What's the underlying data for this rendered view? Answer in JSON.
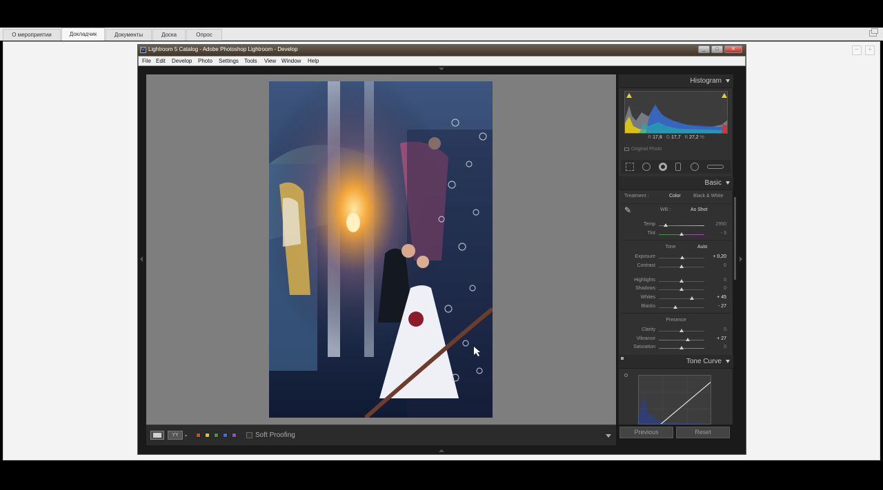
{
  "browser": {
    "tabs": [
      {
        "label": "О мероприятии"
      },
      {
        "label": "Докладчик"
      },
      {
        "label": "Документы"
      },
      {
        "label": "Доска"
      },
      {
        "label": "Опрос"
      }
    ],
    "active_tab": "Докладчик",
    "zoom_out": "−",
    "zoom_in": "+"
  },
  "lightroom": {
    "window_title": "Lightroom 5 Catalog - Adobe Photoshop Lightroom - Develop",
    "app_icon_text": "Lr",
    "menu": [
      "File",
      "Edit",
      "Develop",
      "Photo",
      "Settings",
      "Tools",
      "View",
      "Window",
      "Help"
    ],
    "toolbar": {
      "before_after_label": "YY",
      "soft_proofing_label": "Soft Proofing",
      "color_flags": [
        "#d9452c",
        "#d8c52a",
        "#3e9a3b",
        "#3a6fd0",
        "#8a52c9"
      ]
    },
    "panel": {
      "histogram_title": "Histogram",
      "rgb": {
        "r_label": "R",
        "r": "17,8",
        "g_label": "G",
        "g": "17,7",
        "b_label": "B",
        "b": "27,2",
        "unit": "%"
      },
      "original_photo_label": "Original Photo",
      "basic_title": "Basic",
      "treatment_label": "Treatment :",
      "treatment_color": "Color",
      "treatment_bw": "Black & White",
      "wb_label": "WB :",
      "wb_value": "As Shot",
      "temp": {
        "label": "Temp",
        "value": "2950",
        "pos": 0.15
      },
      "tint": {
        "label": "Tint",
        "value": "- 3",
        "pos": 0.5
      },
      "tone_label": "Tone",
      "auto_label": "Auto",
      "exposure": {
        "label": "Exposure",
        "value": "+ 0,20",
        "pos": 0.52
      },
      "contrast": {
        "label": "Contrast",
        "value": "0",
        "pos": 0.5
      },
      "highlights": {
        "label": "Highlights",
        "value": "0",
        "pos": 0.5
      },
      "shadows": {
        "label": "Shadows",
        "value": "0",
        "pos": 0.5
      },
      "whites": {
        "label": "Whites",
        "value": "+ 45",
        "pos": 0.72
      },
      "blacks": {
        "label": "Blacks",
        "value": "- 27",
        "pos": 0.37
      },
      "presence_label": "Presence",
      "clarity": {
        "label": "Clarity",
        "value": "0",
        "pos": 0.5
      },
      "vibrance": {
        "label": "Vibrance",
        "value": "+ 27",
        "pos": 0.63
      },
      "saturation": {
        "label": "Saturation",
        "value": "0",
        "pos": 0.5
      },
      "tone_curve_title": "Tone Curve",
      "previous_label": "Previous",
      "reset_label": "Reset"
    }
  }
}
